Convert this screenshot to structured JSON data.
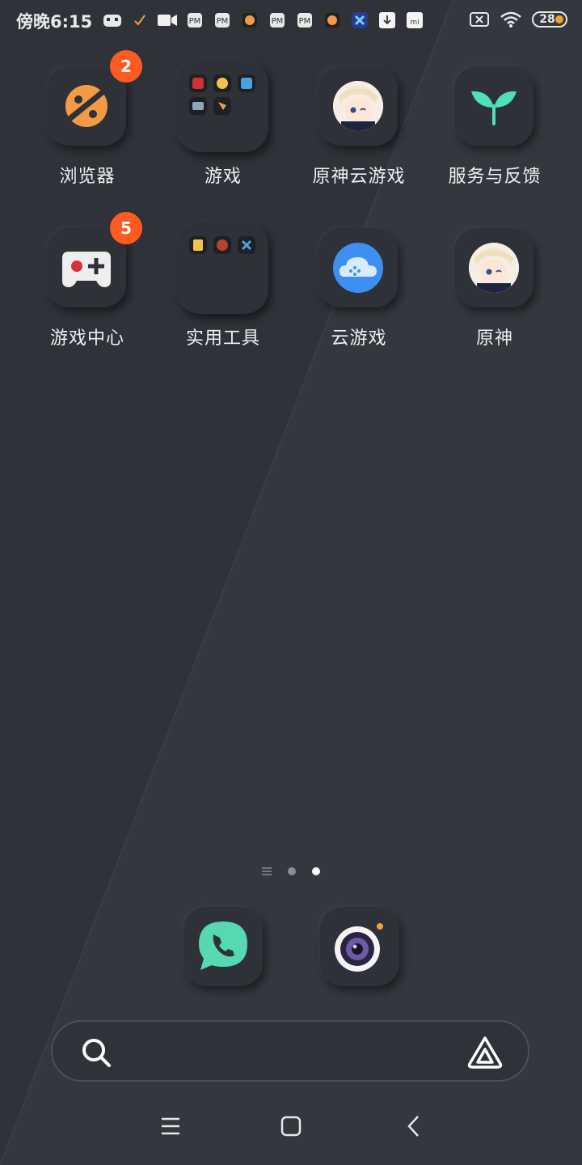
{
  "status_bar": {
    "time": "傍晚6:15",
    "battery": "28",
    "icons": [
      "gamepad-icon",
      "check-icon",
      "video-icon",
      "game-controller-icon",
      "game-controller-icon",
      "browser-icon",
      "game-controller-icon",
      "game-controller-icon",
      "browser-icon",
      "x-app-icon",
      "download-icon",
      "mi-icon"
    ]
  },
  "apps": [
    {
      "label": "浏览器",
      "badge": "2",
      "icon": "browser-planet-icon"
    },
    {
      "label": "游戏",
      "folder": true
    },
    {
      "label": "原神云游戏",
      "icon": "genshin-cloud-avatar"
    },
    {
      "label": "服务与反馈",
      "icon": "sprout-icon"
    },
    {
      "label": "游戏中心",
      "badge": "5",
      "icon": "game-center-icon"
    },
    {
      "label": "实用工具",
      "folder": true
    },
    {
      "label": "云游戏",
      "icon": "cloud-game-icon"
    },
    {
      "label": "原神",
      "icon": "genshin-avatar"
    }
  ],
  "page_indicator": {
    "pages": 2,
    "active": 2
  },
  "dock": [
    {
      "name": "phone",
      "icon": "phone-icon"
    },
    {
      "name": "camera",
      "icon": "camera-icon"
    }
  ],
  "search": {
    "placeholder": ""
  },
  "nav": {
    "menu": "menu-icon",
    "home": "home-icon",
    "back": "back-icon"
  },
  "colors": {
    "background": "#2f3238",
    "badge": "#ff5a1f",
    "browser": "#f39a45",
    "sprout": "#4fe0b5",
    "phone": "#56d9b0",
    "cloud": "#3d8ff2"
  }
}
